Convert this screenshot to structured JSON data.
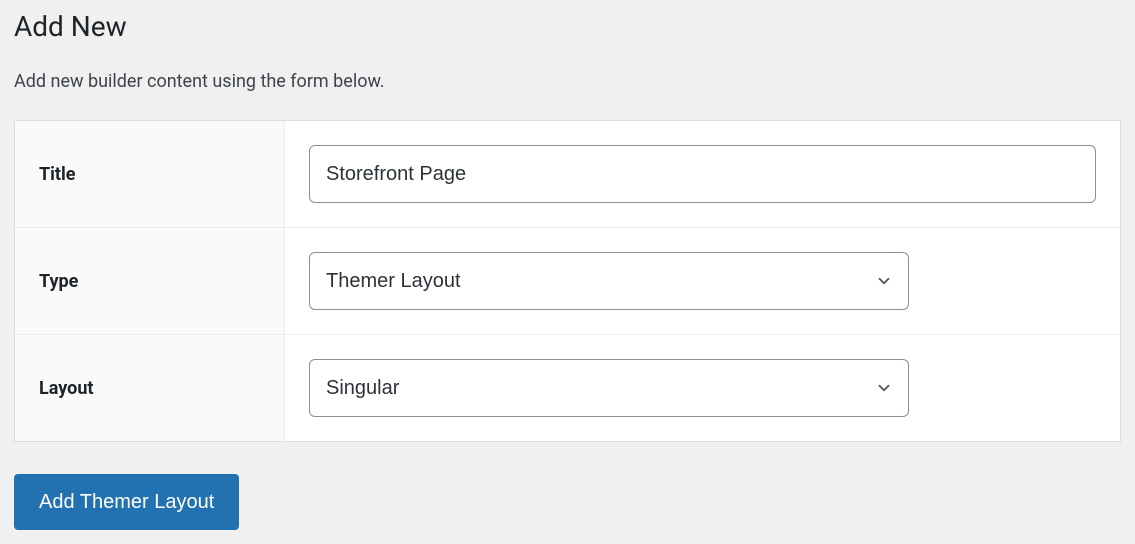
{
  "page": {
    "heading": "Add New",
    "description": "Add new builder content using the form below."
  },
  "form": {
    "title_label": "Title",
    "title_value": "Storefront Page",
    "type_label": "Type",
    "type_value": "Themer Layout",
    "layout_label": "Layout",
    "layout_value": "Singular"
  },
  "submit": {
    "label": "Add Themer Layout"
  }
}
